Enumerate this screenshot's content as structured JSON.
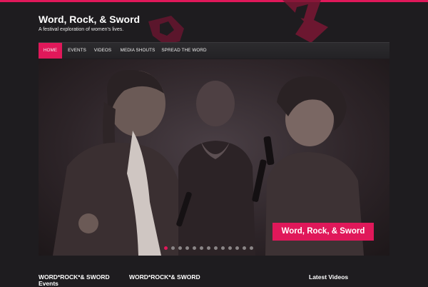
{
  "site": {
    "title": "Word, Rock, & Sword",
    "tagline": "A festival exploration of women's lives."
  },
  "colors": {
    "accent": "#e0185a",
    "background": "#1e1c1f",
    "nav": "#2a292c"
  },
  "nav": {
    "items": [
      {
        "label": "HOME",
        "active": true
      },
      {
        "label": "EVENTS",
        "active": false
      },
      {
        "label": "VIDEOS",
        "active": false
      },
      {
        "label": "MEDIA SHOUTS",
        "active": false
      },
      {
        "label": "SPREAD THE WORD",
        "active": false
      }
    ]
  },
  "slider": {
    "badge": "Word, Rock, & Sword",
    "slide_count": 13,
    "active_index": 0
  },
  "footer": {
    "col1_line1": "WORD*ROCK*& SWORD",
    "col1_line2": "Events",
    "col2_line1": "WORD*ROCK*& SWORD",
    "col3_title": "Latest Videos"
  }
}
